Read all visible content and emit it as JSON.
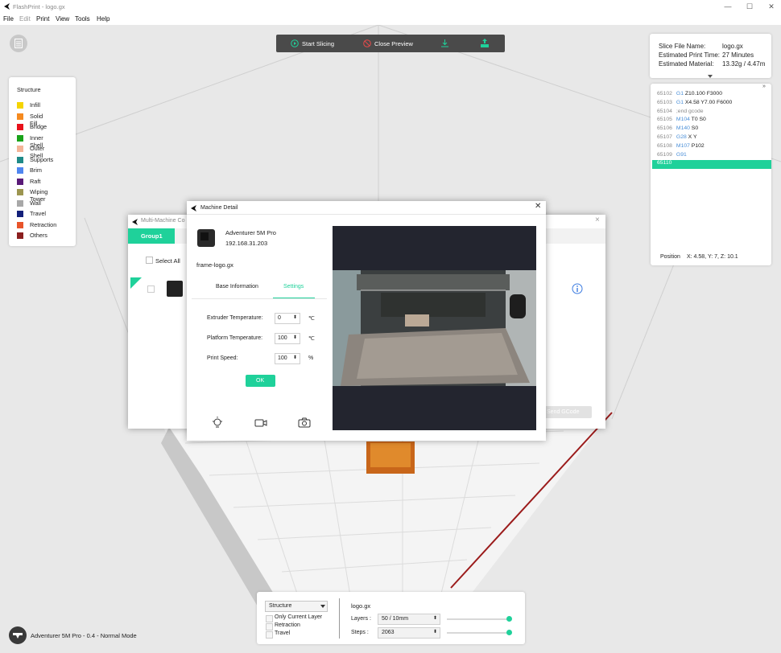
{
  "app": {
    "title": "FlashPrint - logo.gx"
  },
  "menu": [
    "File",
    "Edit",
    "Print",
    "View",
    "Tools",
    "Help"
  ],
  "toolbar": {
    "start_slicing": "Start Slicing",
    "close_preview": "Close Preview"
  },
  "legend": {
    "title": "Structure",
    "items": [
      {
        "label": "Infill",
        "color": "#f5d400"
      },
      {
        "label": "Solid Fill",
        "color": "#f58a1f"
      },
      {
        "label": "Bridge",
        "color": "#e8111b"
      },
      {
        "label": "Inner Shell",
        "color": "#1aa31a"
      },
      {
        "label": "Outer Shell",
        "color": "#f4b498"
      },
      {
        "label": "Supports",
        "color": "#1f8a88"
      },
      {
        "label": "Brim",
        "color": "#4f86f0"
      },
      {
        "label": "Raft",
        "color": "#5a1a78"
      },
      {
        "label": "Wiping Tower",
        "color": "#9c9550"
      },
      {
        "label": "Wall",
        "color": "#a8a8a8"
      },
      {
        "label": "Travel",
        "color": "#13207a"
      },
      {
        "label": "Retraction",
        "color": "#e8542a"
      },
      {
        "label": "Others",
        "color": "#8b1f1f"
      }
    ]
  },
  "slice_info": {
    "file_label": "Slice File Name:",
    "file_value": "logo.gx",
    "time_label": "Estimated Print Time:",
    "time_value": "27 Minutes",
    "material_label": "Estimated Material:",
    "material_value": "13.32g / 4.47m"
  },
  "gcode": [
    {
      "num": "65102",
      "cmd": "G1",
      "args": " Z10.100 F3000"
    },
    {
      "num": "65103",
      "cmd": "G1",
      "args": " X4.58 Y7.00 F6000"
    },
    {
      "num": "65104",
      "cmd": "",
      "args": ";end gcode"
    },
    {
      "num": "65105",
      "cmd": "M104",
      "args": " T0 S0"
    },
    {
      "num": "65106",
      "cmd": "M140",
      "args": " S0"
    },
    {
      "num": "65107",
      "cmd": "G28",
      "args": " X Y"
    },
    {
      "num": "65108",
      "cmd": "M107",
      "args": " P102"
    },
    {
      "num": "65109",
      "cmd": "G91",
      "args": ""
    },
    {
      "num": "65110",
      "cmd": "",
      "args": ""
    }
  ],
  "position": {
    "label": "Position",
    "value": "X: 4.58, Y: 7, Z: 10.1"
  },
  "multi_machine": {
    "title": "Multi-Machine Co",
    "group": "Group1",
    "select_all": "Select All",
    "send_gcode": "Send GCode"
  },
  "machine_detail": {
    "title": "Machine Detail",
    "name": "Adventurer 5M Pro",
    "ip": "192.168.31.203",
    "file": "frame-logo.gx",
    "tabs": [
      "Base Information",
      "Settings"
    ],
    "fields": [
      {
        "label": "Extruder Temperature:",
        "value": "0",
        "unit": "℃"
      },
      {
        "label": "Platform Temperature:",
        "value": "100",
        "unit": "℃"
      },
      {
        "label": "Print Speed:",
        "value": "100",
        "unit": "%"
      }
    ],
    "ok": "OK"
  },
  "bottom": {
    "mode_select": "Structure",
    "checks": [
      "Only Current Layer",
      "Retraction",
      "Travel"
    ],
    "file": "logo.gx",
    "layers_label": "Layers :",
    "layers_value": "50 / 10mm",
    "steps_label": "Steps :",
    "steps_value": "2063"
  },
  "status": {
    "text": "Adventurer 5M Pro - 0.4 - Normal Mode"
  },
  "colors": {
    "accent": "#1fd19a",
    "toolbar": "#4a4a4a"
  }
}
